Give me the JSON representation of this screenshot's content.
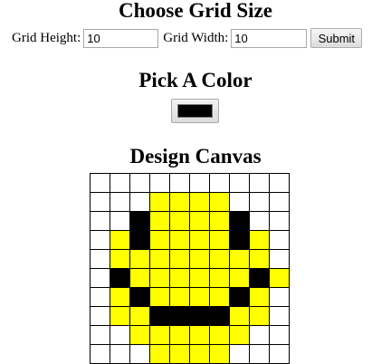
{
  "grid_size": {
    "heading": "Choose Grid Size",
    "height_label": "Grid Height:",
    "height_value": "10",
    "width_label": "Grid Width:",
    "width_value": "10",
    "submit_label": "Submit"
  },
  "color_picker": {
    "heading": "Pick A Color",
    "selected_color": "#000000"
  },
  "canvas": {
    "heading": "Design Canvas",
    "rows": 10,
    "cols": 10,
    "palette": {
      "w": "#ffffff",
      "y": "#ffff00",
      "b": "#000000"
    },
    "cells": [
      "wwwwwwwwww",
      "wwwyyyywww",
      "wwbyyyybww",
      "wybyyyybyw",
      "wyyyyyyyyw",
      "wbyyyyyyby",
      "wybyyyybyw",
      "wyybbbbyyw",
      "wwyyyyyyww",
      "wwwyyyywww"
    ]
  }
}
